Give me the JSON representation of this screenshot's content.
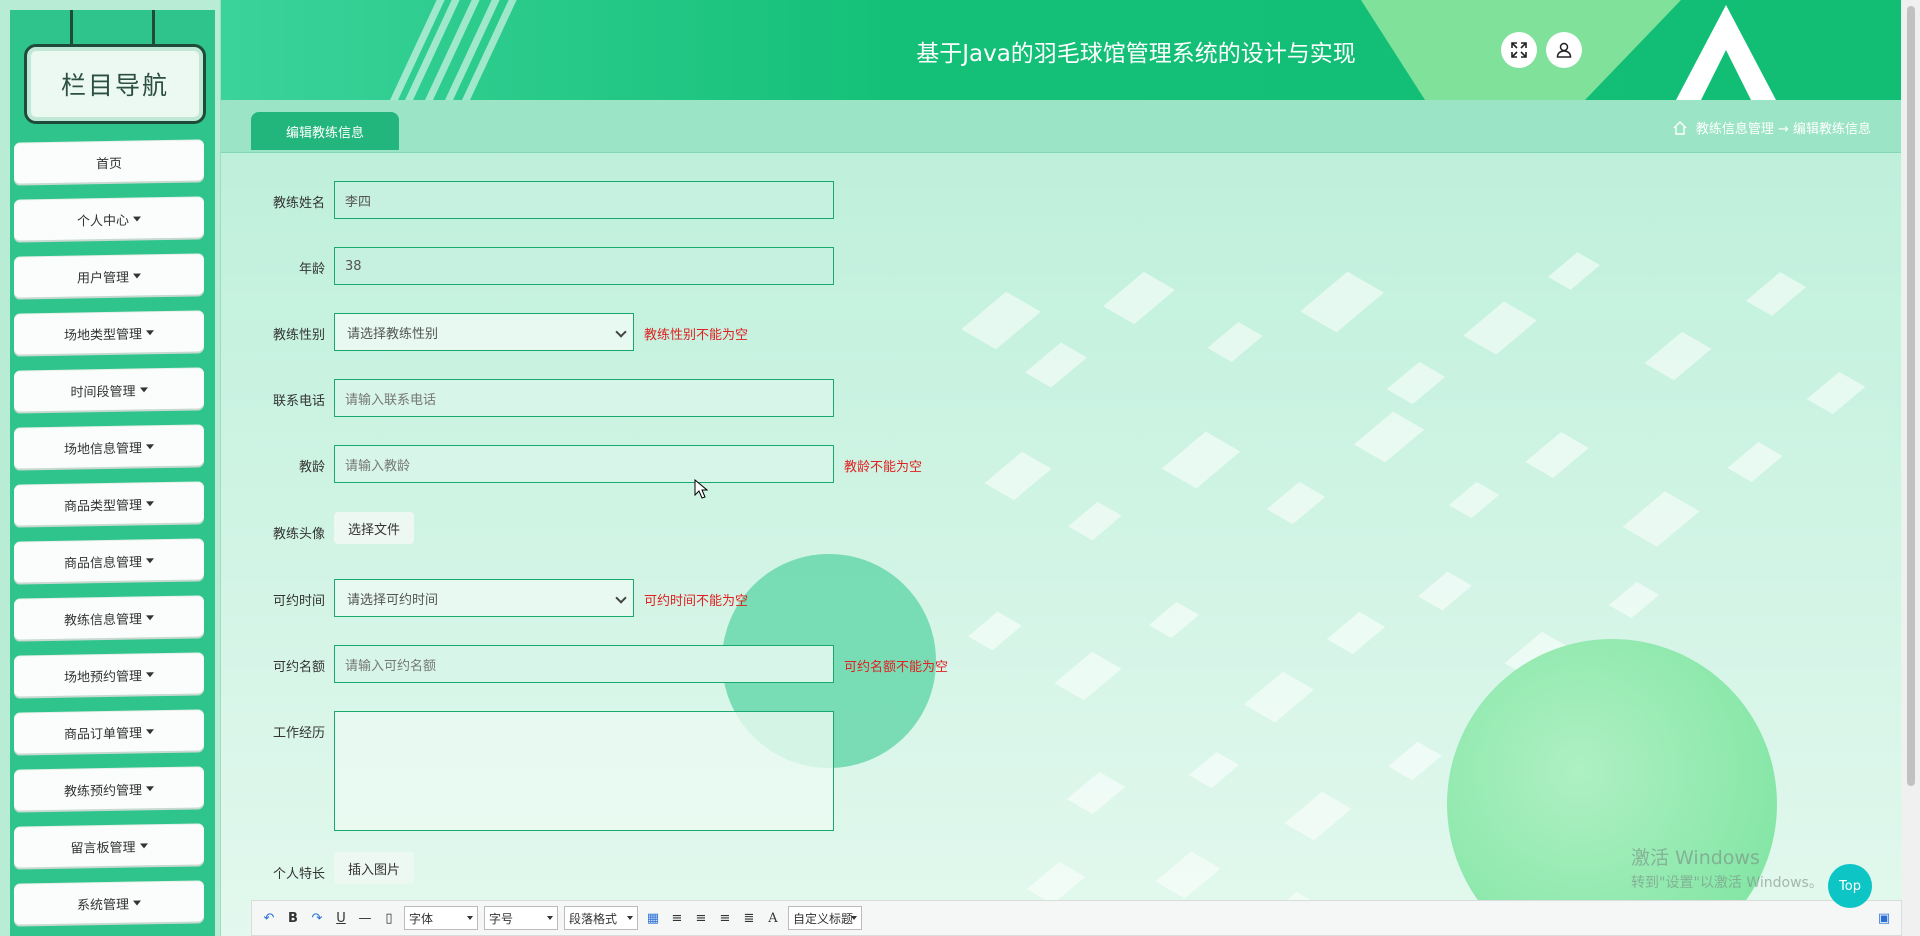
{
  "sidebar": {
    "title": "栏目导航",
    "items": [
      {
        "label": "首页",
        "caret": false
      },
      {
        "label": "个人中心",
        "caret": true
      },
      {
        "label": "用户管理",
        "caret": true
      },
      {
        "label": "场地类型管理",
        "caret": true
      },
      {
        "label": "时间段管理",
        "caret": true
      },
      {
        "label": "场地信息管理",
        "caret": true
      },
      {
        "label": "商品类型管理",
        "caret": true
      },
      {
        "label": "商品信息管理",
        "caret": true
      },
      {
        "label": "教练信息管理",
        "caret": true
      },
      {
        "label": "场地预约管理",
        "caret": true
      },
      {
        "label": "商品订单管理",
        "caret": true
      },
      {
        "label": "教练预约管理",
        "caret": true
      },
      {
        "label": "留言板管理",
        "caret": true
      },
      {
        "label": "系统管理",
        "caret": true
      }
    ]
  },
  "header": {
    "title": "基于Java的羽毛球馆管理系统的设计与实现",
    "fullscreen_icon": "fullscreen-icon",
    "user_icon": "user-icon"
  },
  "tabs": {
    "active": "编辑教练信息"
  },
  "breadcrumb": {
    "home_icon": "home-icon",
    "path": "教练信息管理 → 编辑教练信息"
  },
  "form": {
    "coach_name": {
      "label": "教练姓名",
      "value": "李四"
    },
    "age": {
      "label": "年龄",
      "value": "38"
    },
    "gender": {
      "label": "教练性别",
      "value": "请选择教练性别",
      "error": "教练性别不能为空"
    },
    "phone": {
      "label": "联系电话",
      "placeholder": "请输入联系电话"
    },
    "years": {
      "label": "教龄",
      "placeholder": "请输入教龄",
      "error": "教龄不能为空"
    },
    "avatar": {
      "label": "教练头像",
      "button": "选择文件"
    },
    "available_time": {
      "label": "可约时间",
      "value": "请选择可约时间",
      "error": "可约时间不能为空"
    },
    "quota": {
      "label": "可约名额",
      "placeholder": "请输入可约名额",
      "error": "可约名额不能为空"
    },
    "experience": {
      "label": "工作经历"
    },
    "specialty": {
      "label": "个人特长",
      "button": "插入图片"
    }
  },
  "editor_toolbar": {
    "font": "字体",
    "size": "字号",
    "paragraph": "段落格式",
    "custom_title": "自定义标题",
    "bold": "B",
    "underline": "U",
    "font_color": "A"
  },
  "watermark": {
    "line1": "激活 Windows",
    "line2": "转到\"设置\"以激活 Windows。"
  },
  "top_button": "Top",
  "colors": {
    "primary": "#12be74",
    "sidebar": "#2fc48b",
    "error": "#e02020",
    "top_button": "#0ec5c5"
  }
}
